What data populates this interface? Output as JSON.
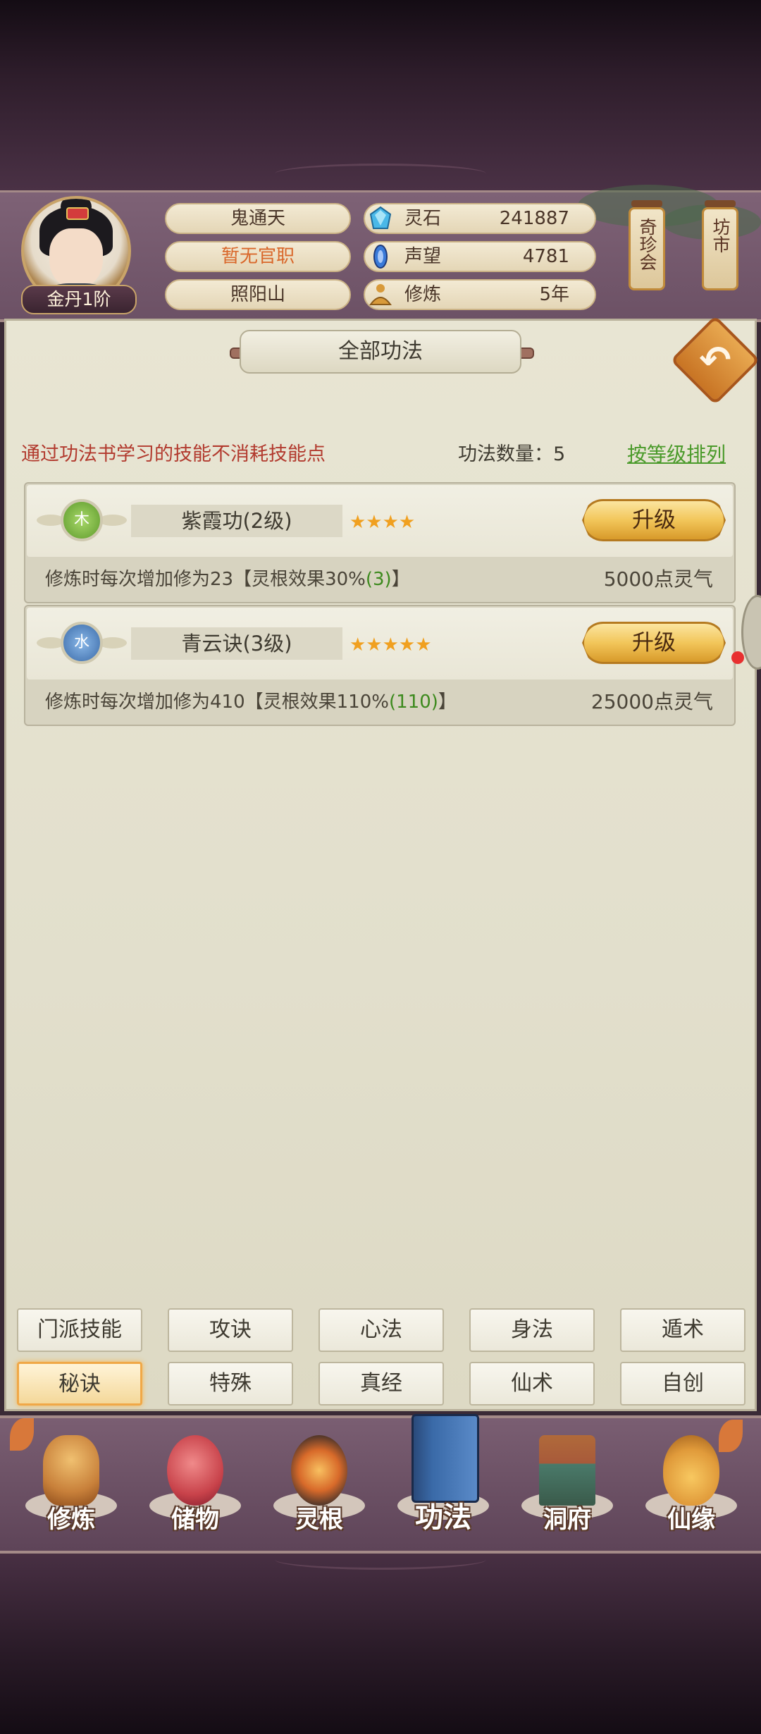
{
  "player": {
    "rank": "金丹1阶",
    "name": "鬼通天",
    "official_title": "暂无官职",
    "location": "照阳山"
  },
  "resources": [
    {
      "label": "灵石",
      "value": "241887",
      "icon": "spirit-stone-icon",
      "color": "#4ab8e8"
    },
    {
      "label": "声望",
      "value": "4781",
      "icon": "reputation-icon",
      "color": "#3a7ad8"
    },
    {
      "label": "修炼",
      "value": "5年",
      "icon": "meditation-icon",
      "color": "#d89a3a"
    }
  ],
  "shops": {
    "qizhenhui": "奇珍会",
    "fangshi": "坊市"
  },
  "panel": {
    "title": "全部功法",
    "info": "通过功法书学习的技能不消耗技能点",
    "count_label": "功法数量：5",
    "sort_label": "按等级排列"
  },
  "skills": [
    {
      "element": "木",
      "name": "紫霞功(2级)",
      "stars": "★★★★",
      "upgrade": "升级",
      "desc_pre": "修炼时每次增加修为23【灵根效果30%",
      "desc_green": "(3)",
      "desc_post": "】",
      "cost": "5000点灵气"
    },
    {
      "element": "水",
      "name": "青云诀(3级)",
      "stars": "★★★★★",
      "upgrade": "升级",
      "desc_pre": "修炼时每次增加修为410【灵根效果110%",
      "desc_green": "(110)",
      "desc_post": "】",
      "cost": "25000点灵气"
    }
  ],
  "categories": {
    "row1": [
      "门派技能",
      "攻诀",
      "心法",
      "身法",
      "遁术"
    ],
    "row2": [
      "秘诀",
      "特殊",
      "真经",
      "仙术",
      "自创"
    ],
    "active": "秘诀"
  },
  "nav": [
    {
      "label": "修炼",
      "icon": "cultivation-icon",
      "color": "#c8803a"
    },
    {
      "label": "储物",
      "icon": "storage-bag-icon",
      "color": "#c8424a"
    },
    {
      "label": "灵根",
      "icon": "spirit-root-icon",
      "color": "#d86a2a"
    },
    {
      "label": "功法",
      "icon": "skill-book-icon",
      "color": "#3a6aa8",
      "active": true
    },
    {
      "label": "洞府",
      "icon": "cave-dwelling-icon",
      "color": "#a85a3a"
    },
    {
      "label": "仙缘",
      "icon": "fortune-gourd-icon",
      "color": "#e09a3a"
    }
  ]
}
